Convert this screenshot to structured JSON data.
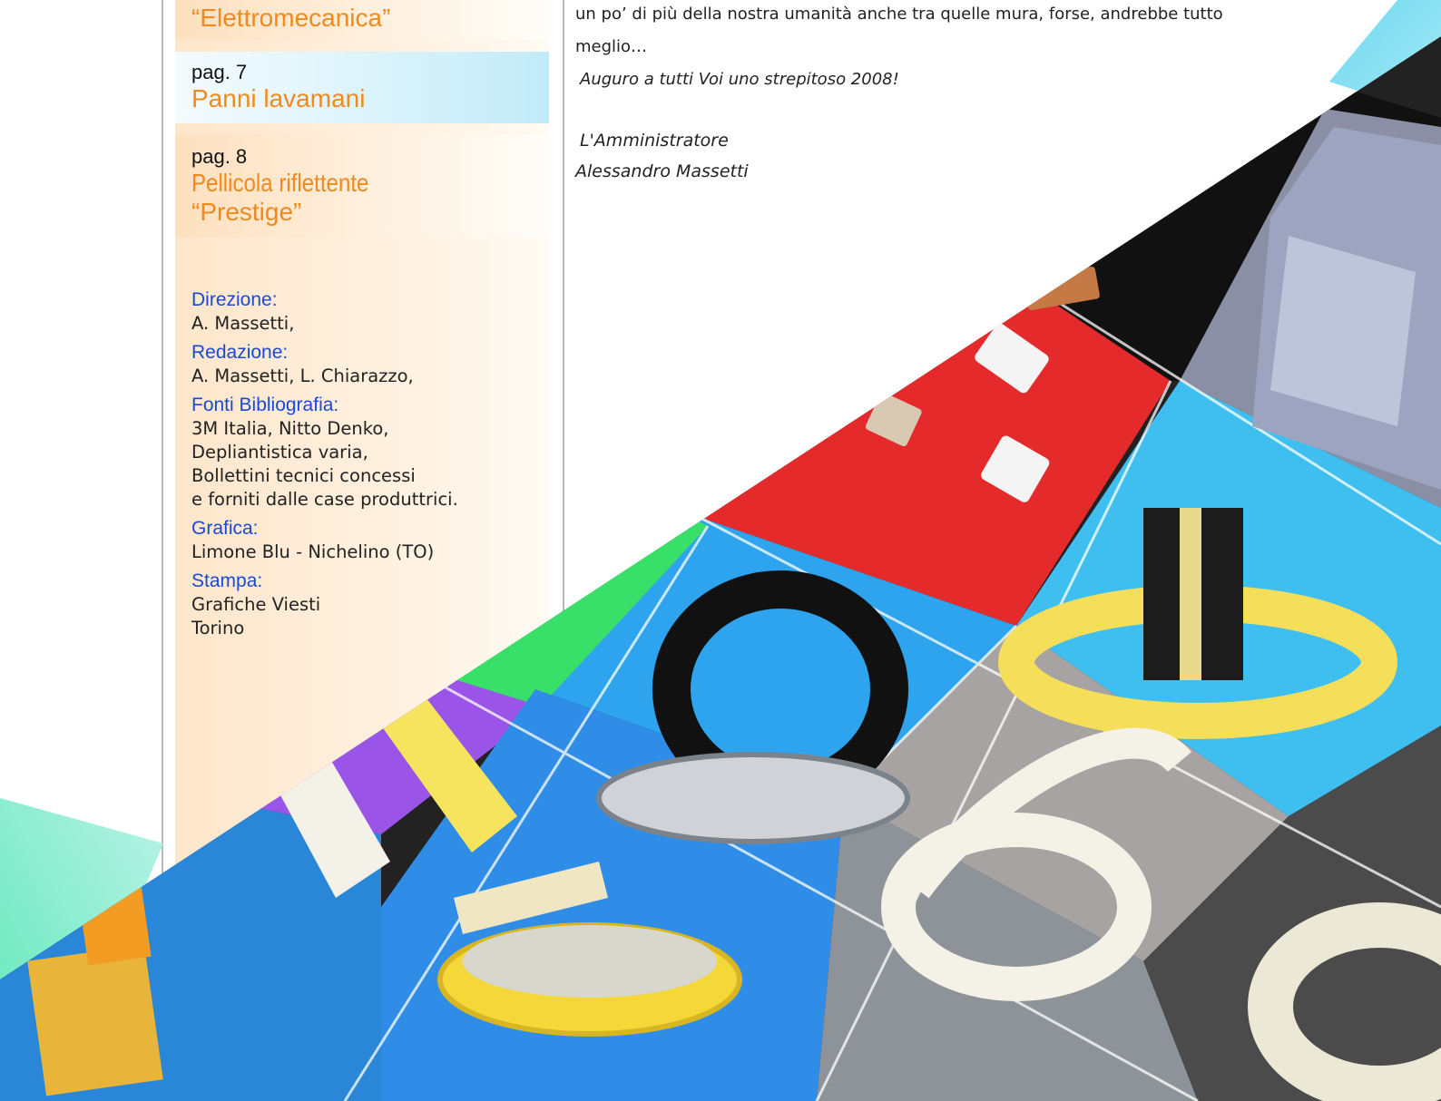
{
  "toc": [
    {
      "page": "",
      "title": "“Elettromecanica”"
    },
    {
      "page": "pag. 7",
      "title": "Panni lavamani"
    },
    {
      "page": "pag. 8",
      "title_line1": "Pellicola riflettente",
      "title_line2": "“Prestige”"
    }
  ],
  "credits": {
    "direzione_label": "Direzione:",
    "direzione_value": "A. Massetti,",
    "redazione_label": "Redazione:",
    "redazione_value": "A. Massetti, L. Chiarazzo,",
    "fonti_label": "Fonti Bibliografia:",
    "fonti_lines": [
      "3M Italia, Nitto Denko,",
      "Depliantistica varia,",
      "Bollettini tecnici concessi",
      "e forniti dalle case produttrici."
    ],
    "grafica_label": "Grafica:",
    "grafica_value": "Limone Blu - Nichelino (TO)",
    "stampa_label": "Stampa:",
    "stampa_lines": [
      "Grafiche Viesti",
      "Torino"
    ]
  },
  "editorial": {
    "line1": "un po’ di più della nostra umanità anche tra quelle mura, forse, andrebbe tutto",
    "line2": "meglio…",
    "wish": "Auguro a tutti Voi uno strepitoso 2008!",
    "signature_role": "L'Amministratore",
    "signature_name": "Alessandro Massetti"
  }
}
